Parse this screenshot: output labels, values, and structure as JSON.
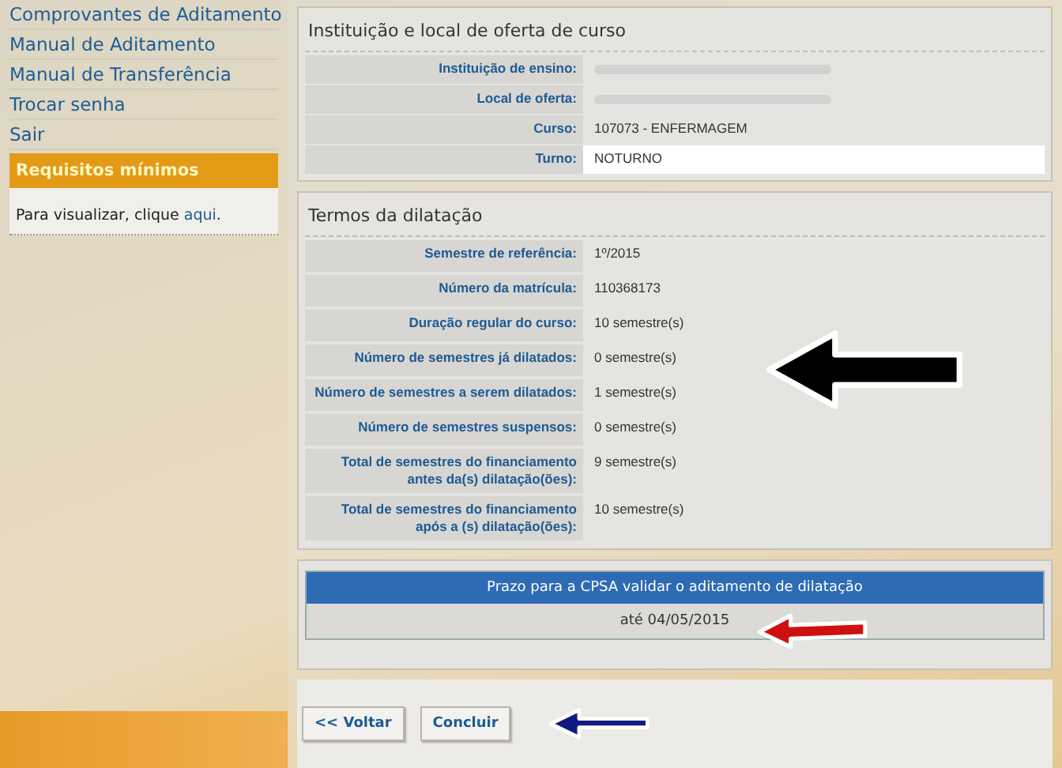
{
  "sidebar": {
    "items": [
      {
        "label": "Comprovantes de Aditamento"
      },
      {
        "label": "Manual de Aditamento"
      },
      {
        "label": "Manual de Transferência"
      },
      {
        "label": "Trocar senha"
      },
      {
        "label": "Sair"
      }
    ],
    "requirements_box": {
      "title": "Requisitos mínimos",
      "text": "Para visualizar, clique ",
      "link": "aqui",
      "after": "."
    }
  },
  "course_section": {
    "title": "Instituição e local de oferta de curso",
    "rows": [
      {
        "label": "Instituição de ensino:",
        "value": null,
        "redacted": true,
        "highlighted": false
      },
      {
        "label": "Local de oferta:",
        "value": null,
        "redacted": true,
        "highlighted": false
      },
      {
        "label": "Curso:",
        "value": "107073 - ENFERMAGEM",
        "redacted": false,
        "highlighted": false
      },
      {
        "label": "Turno:",
        "value": "NOTURNO",
        "redacted": false,
        "highlighted": true
      }
    ]
  },
  "extension_section": {
    "title": "Termos da dilatação",
    "rows": [
      {
        "label": "Semestre de referência:",
        "value": "1º/2015"
      },
      {
        "label": "Número da matrícula:",
        "value": "110368173"
      },
      {
        "label": "Duração regular do curso:",
        "value": "10 semestre(s)"
      },
      {
        "label": "Número de semestres já dilatados:",
        "value": "0 semestre(s)"
      },
      {
        "label": "Número de semestres a serem dilatados:",
        "value": "1 semestre(s)"
      },
      {
        "label": "Número de semestres suspensos:",
        "value": "0 semestre(s)"
      },
      {
        "label": "Total de semestres do financiamento antes da(s) dilatação(ões):",
        "value": "9 semestre(s)"
      },
      {
        "label": "Total de semestres do financiamento após a (s) dilatação(ões):",
        "value": "10 semestre(s)"
      }
    ]
  },
  "deadline": {
    "title": "Prazo para a CPSA validar o aditamento de dilatação",
    "value": "até 04/05/2015"
  },
  "buttons": [
    {
      "label": "<< Voltar"
    },
    {
      "label": "Concluir"
    }
  ]
}
